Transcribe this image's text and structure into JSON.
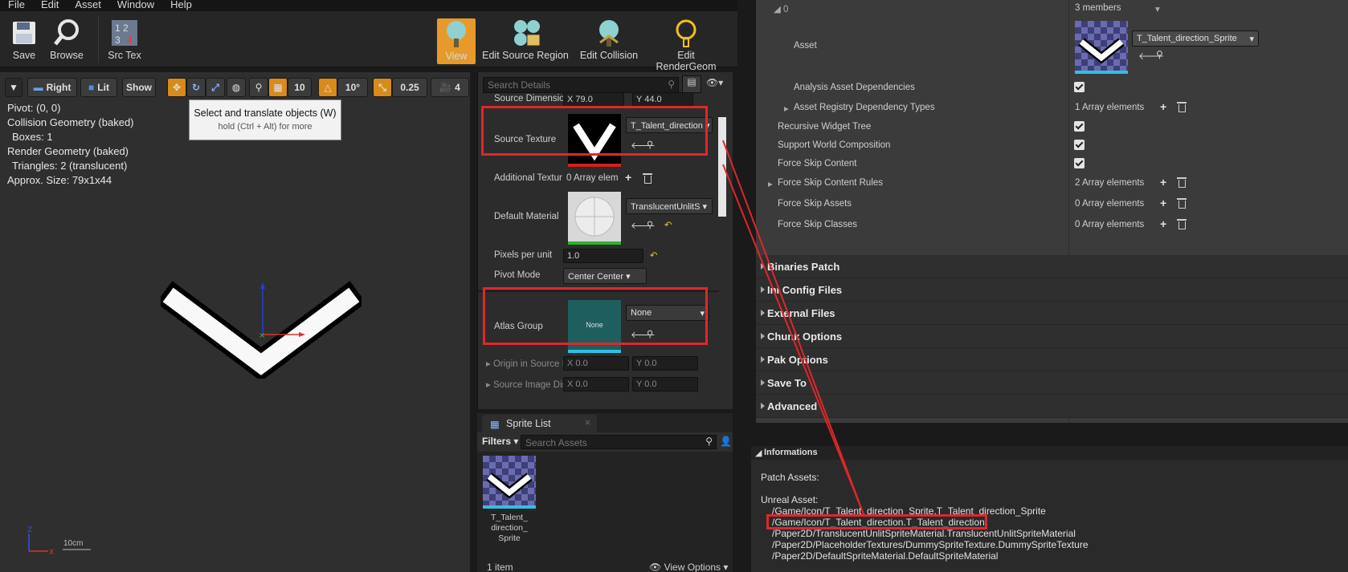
{
  "menu": [
    "File",
    "Edit",
    "Asset",
    "Window",
    "Help"
  ],
  "toolbar": {
    "save": "Save",
    "browse": "Browse",
    "src_tex": "Src Tex",
    "view": "View",
    "edit_source_region": "Edit Source Region",
    "edit_collision": "Edit Collision",
    "edit_render_geom": "Edit RenderGeom"
  },
  "viewport_toolbar": {
    "right": "Right",
    "lit": "Lit",
    "show": "Show",
    "grid_snap": "10",
    "rot_snap": "10°",
    "scale_snap": "0.25",
    "cam_speed": "4"
  },
  "tooltip": {
    "title": "Select and translate objects (W)",
    "hint": "hold (Ctrl + Alt) for more"
  },
  "viewport_info": [
    "Pivot: (0, 0)",
    "Collision Geometry (baked)",
    "  Boxes: 1",
    "Render Geometry (baked)",
    "  Triangles: 2 (translucent)",
    "Approx. Size: 79x1x44"
  ],
  "scale_label": "10cm",
  "details": {
    "search_placeholder": "Search Details",
    "source_dimension_label": "Source Dimensio",
    "source_dimension_x": "79.0",
    "source_dimension_y": "44.0",
    "source_texture_label": "Source Texture",
    "source_texture_value": "T_Talent_direction",
    "additional_textures_label": "Additional Textur",
    "additional_textures_value": "0 Array elem",
    "default_material_label": "Default Material",
    "default_material_value": "TranslucentUnlitS",
    "pixels_per_unit_label": "Pixels per unit",
    "pixels_per_unit_value": "1.0",
    "pivot_mode_label": "Pivot Mode",
    "pivot_mode_value": "Center Center",
    "atlas_group_label": "Atlas Group",
    "atlas_group_value": "None",
    "atlas_thumb_text": "None",
    "origin_label": "Origin in Source I",
    "origin_x": "0.0",
    "origin_y": "0.0",
    "source_image_dim_label": "Source Image Dir",
    "source_image_dim_x": "0.0",
    "source_image_dim_y": "0.0",
    "x": "X",
    "y": "Y"
  },
  "sprite_list": {
    "tab": "Sprite List",
    "filters": "Filters",
    "search_placeholder": "Search Assets",
    "item_label": "T_Talent_\ndirection_\nSprite",
    "count": "1 item",
    "view_options": "View Options"
  },
  "right_panel": {
    "index_label": "0",
    "index_value": "3 members",
    "asset_label": "Asset",
    "asset_value": "T_Talent_direction_Sprite",
    "rows": [
      {
        "label": "Analysis Asset Dependencies",
        "type": "check"
      },
      {
        "label": "Asset Registry Dependency Types",
        "type": "array",
        "value": "1 Array elements"
      },
      {
        "label": "Recursive Widget Tree",
        "type": "check"
      },
      {
        "label": "Support World Composition",
        "type": "check"
      },
      {
        "label": "Force Skip Content",
        "type": "check"
      },
      {
        "label": "Force Skip Content Rules",
        "type": "array",
        "value": "2 Array elements"
      },
      {
        "label": "Force Skip Assets",
        "type": "array",
        "value": "0 Array elements"
      },
      {
        "label": "Force Skip Classes",
        "type": "array",
        "value": "0 Array elements"
      }
    ],
    "sections": [
      "Binaries Patch",
      "Ini Config Files",
      "External Files",
      "Chunk Options",
      "Pak Options",
      "Save To",
      "Advanced"
    ]
  },
  "informations": {
    "header": "Informations",
    "patch_assets": "Patch Assets:",
    "unreal_asset": "Unreal Asset:",
    "lines": [
      "/Game/Icon/T_Talent_direction_Sprite.T_Talent_direction_Sprite",
      "/Game/Icon/T_Talent_direction.T_Talent_direction",
      "/Paper2D/TranslucentUnlitSpriteMaterial.TranslucentUnlitSpriteMaterial",
      "/Paper2D/PlaceholderTextures/DummySpriteTexture.DummySpriteTexture",
      "/Paper2D/DefaultSpriteMaterial.DefaultSpriteMaterial"
    ]
  },
  "colors": {
    "highlight": "#e0262c",
    "accent": "#e79a2a"
  }
}
